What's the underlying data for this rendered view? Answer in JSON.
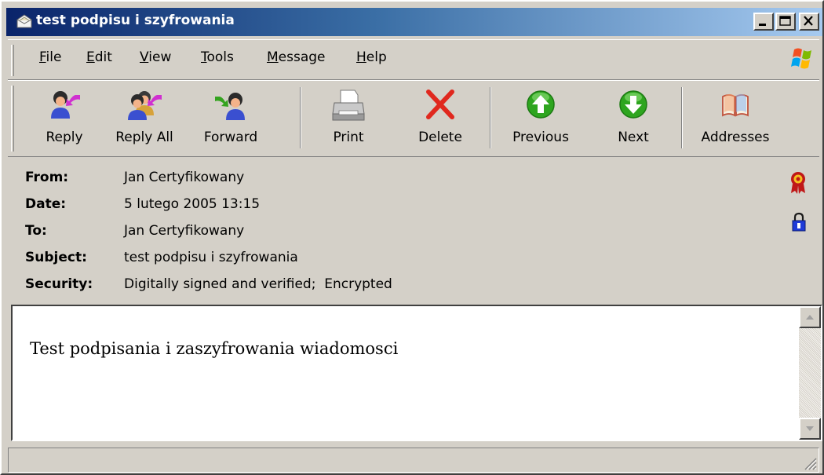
{
  "window": {
    "title": "test podpisu i szyfrowania",
    "icon": "envelope-icon",
    "controls": [
      "minimize-icon",
      "maximize-icon",
      "close-icon"
    ]
  },
  "menu": {
    "items": [
      {
        "label": "File"
      },
      {
        "label": "Edit"
      },
      {
        "label": "View"
      },
      {
        "label": "Tools"
      },
      {
        "label": "Message"
      },
      {
        "label": "Help"
      }
    ]
  },
  "toolbar": {
    "buttons": [
      {
        "label": "Reply",
        "icon": "reply-icon"
      },
      {
        "label": "Reply All",
        "icon": "reply-all-icon"
      },
      {
        "label": "Forward",
        "icon": "forward-icon"
      },
      {
        "label": "Print",
        "icon": "printer-icon"
      },
      {
        "label": "Delete",
        "icon": "delete-x-icon"
      },
      {
        "label": "Previous",
        "icon": "arrow-up-icon"
      },
      {
        "label": "Next",
        "icon": "arrow-down-icon"
      },
      {
        "label": "Addresses",
        "icon": "address-book-icon"
      }
    ]
  },
  "headers": {
    "from": {
      "label": "From:",
      "value": "Jan Certyfikowany"
    },
    "date": {
      "label": "Date:",
      "value": "5 lutego 2005 13:15"
    },
    "to": {
      "label": "To:",
      "value": "Jan Certyfikowany"
    },
    "subject": {
      "label": "Subject:",
      "value": "test podpisu i szyfrowania"
    },
    "security": {
      "label": "Security:",
      "value": "Digitally signed and verified;  Encrypted"
    }
  },
  "message": {
    "body": "Test podpisania i zaszyfrowania wiadomosci"
  },
  "colors": {
    "titlebar_start": "#0a246a",
    "titlebar_end": "#a6caf0",
    "chrome": "#d4d0c8",
    "arrow_green": "#2ea51f",
    "delete_red": "#e0281e"
  }
}
